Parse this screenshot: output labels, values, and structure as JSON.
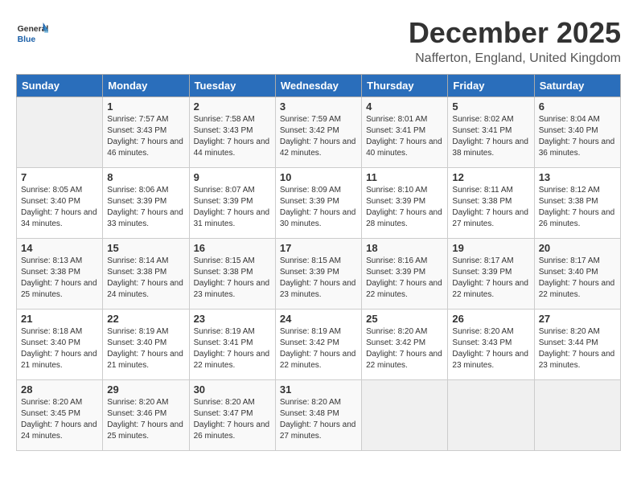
{
  "header": {
    "logo_line1": "General",
    "logo_line2": "Blue",
    "title": "December 2025",
    "subtitle": "Nafferton, England, United Kingdom"
  },
  "days_of_week": [
    "Sunday",
    "Monday",
    "Tuesday",
    "Wednesday",
    "Thursday",
    "Friday",
    "Saturday"
  ],
  "weeks": [
    [
      {
        "day": "",
        "empty": true
      },
      {
        "day": "1",
        "sunrise": "Sunrise: 7:57 AM",
        "sunset": "Sunset: 3:43 PM",
        "daylight": "Daylight: 7 hours and 46 minutes."
      },
      {
        "day": "2",
        "sunrise": "Sunrise: 7:58 AM",
        "sunset": "Sunset: 3:43 PM",
        "daylight": "Daylight: 7 hours and 44 minutes."
      },
      {
        "day": "3",
        "sunrise": "Sunrise: 7:59 AM",
        "sunset": "Sunset: 3:42 PM",
        "daylight": "Daylight: 7 hours and 42 minutes."
      },
      {
        "day": "4",
        "sunrise": "Sunrise: 8:01 AM",
        "sunset": "Sunset: 3:41 PM",
        "daylight": "Daylight: 7 hours and 40 minutes."
      },
      {
        "day": "5",
        "sunrise": "Sunrise: 8:02 AM",
        "sunset": "Sunset: 3:41 PM",
        "daylight": "Daylight: 7 hours and 38 minutes."
      },
      {
        "day": "6",
        "sunrise": "Sunrise: 8:04 AM",
        "sunset": "Sunset: 3:40 PM",
        "daylight": "Daylight: 7 hours and 36 minutes."
      }
    ],
    [
      {
        "day": "7",
        "sunrise": "Sunrise: 8:05 AM",
        "sunset": "Sunset: 3:40 PM",
        "daylight": "Daylight: 7 hours and 34 minutes."
      },
      {
        "day": "8",
        "sunrise": "Sunrise: 8:06 AM",
        "sunset": "Sunset: 3:39 PM",
        "daylight": "Daylight: 7 hours and 33 minutes."
      },
      {
        "day": "9",
        "sunrise": "Sunrise: 8:07 AM",
        "sunset": "Sunset: 3:39 PM",
        "daylight": "Daylight: 7 hours and 31 minutes."
      },
      {
        "day": "10",
        "sunrise": "Sunrise: 8:09 AM",
        "sunset": "Sunset: 3:39 PM",
        "daylight": "Daylight: 7 hours and 30 minutes."
      },
      {
        "day": "11",
        "sunrise": "Sunrise: 8:10 AM",
        "sunset": "Sunset: 3:39 PM",
        "daylight": "Daylight: 7 hours and 28 minutes."
      },
      {
        "day": "12",
        "sunrise": "Sunrise: 8:11 AM",
        "sunset": "Sunset: 3:38 PM",
        "daylight": "Daylight: 7 hours and 27 minutes."
      },
      {
        "day": "13",
        "sunrise": "Sunrise: 8:12 AM",
        "sunset": "Sunset: 3:38 PM",
        "daylight": "Daylight: 7 hours and 26 minutes."
      }
    ],
    [
      {
        "day": "14",
        "sunrise": "Sunrise: 8:13 AM",
        "sunset": "Sunset: 3:38 PM",
        "daylight": "Daylight: 7 hours and 25 minutes."
      },
      {
        "day": "15",
        "sunrise": "Sunrise: 8:14 AM",
        "sunset": "Sunset: 3:38 PM",
        "daylight": "Daylight: 7 hours and 24 minutes."
      },
      {
        "day": "16",
        "sunrise": "Sunrise: 8:15 AM",
        "sunset": "Sunset: 3:38 PM",
        "daylight": "Daylight: 7 hours and 23 minutes."
      },
      {
        "day": "17",
        "sunrise": "Sunrise: 8:15 AM",
        "sunset": "Sunset: 3:39 PM",
        "daylight": "Daylight: 7 hours and 23 minutes."
      },
      {
        "day": "18",
        "sunrise": "Sunrise: 8:16 AM",
        "sunset": "Sunset: 3:39 PM",
        "daylight": "Daylight: 7 hours and 22 minutes."
      },
      {
        "day": "19",
        "sunrise": "Sunrise: 8:17 AM",
        "sunset": "Sunset: 3:39 PM",
        "daylight": "Daylight: 7 hours and 22 minutes."
      },
      {
        "day": "20",
        "sunrise": "Sunrise: 8:17 AM",
        "sunset": "Sunset: 3:40 PM",
        "daylight": "Daylight: 7 hours and 22 minutes."
      }
    ],
    [
      {
        "day": "21",
        "sunrise": "Sunrise: 8:18 AM",
        "sunset": "Sunset: 3:40 PM",
        "daylight": "Daylight: 7 hours and 21 minutes."
      },
      {
        "day": "22",
        "sunrise": "Sunrise: 8:19 AM",
        "sunset": "Sunset: 3:40 PM",
        "daylight": "Daylight: 7 hours and 21 minutes."
      },
      {
        "day": "23",
        "sunrise": "Sunrise: 8:19 AM",
        "sunset": "Sunset: 3:41 PM",
        "daylight": "Daylight: 7 hours and 22 minutes."
      },
      {
        "day": "24",
        "sunrise": "Sunrise: 8:19 AM",
        "sunset": "Sunset: 3:42 PM",
        "daylight": "Daylight: 7 hours and 22 minutes."
      },
      {
        "day": "25",
        "sunrise": "Sunrise: 8:20 AM",
        "sunset": "Sunset: 3:42 PM",
        "daylight": "Daylight: 7 hours and 22 minutes."
      },
      {
        "day": "26",
        "sunrise": "Sunrise: 8:20 AM",
        "sunset": "Sunset: 3:43 PM",
        "daylight": "Daylight: 7 hours and 23 minutes."
      },
      {
        "day": "27",
        "sunrise": "Sunrise: 8:20 AM",
        "sunset": "Sunset: 3:44 PM",
        "daylight": "Daylight: 7 hours and 23 minutes."
      }
    ],
    [
      {
        "day": "28",
        "sunrise": "Sunrise: 8:20 AM",
        "sunset": "Sunset: 3:45 PM",
        "daylight": "Daylight: 7 hours and 24 minutes."
      },
      {
        "day": "29",
        "sunrise": "Sunrise: 8:20 AM",
        "sunset": "Sunset: 3:46 PM",
        "daylight": "Daylight: 7 hours and 25 minutes."
      },
      {
        "day": "30",
        "sunrise": "Sunrise: 8:20 AM",
        "sunset": "Sunset: 3:47 PM",
        "daylight": "Daylight: 7 hours and 26 minutes."
      },
      {
        "day": "31",
        "sunrise": "Sunrise: 8:20 AM",
        "sunset": "Sunset: 3:48 PM",
        "daylight": "Daylight: 7 hours and 27 minutes."
      },
      {
        "day": "",
        "empty": true
      },
      {
        "day": "",
        "empty": true
      },
      {
        "day": "",
        "empty": true
      }
    ]
  ]
}
